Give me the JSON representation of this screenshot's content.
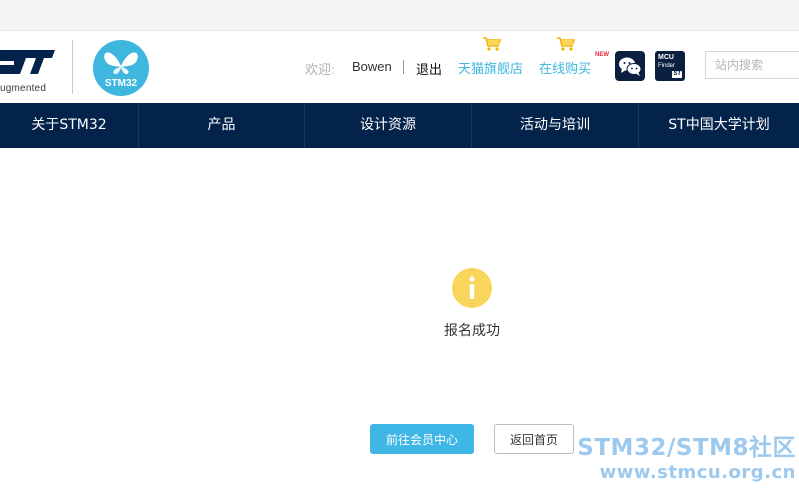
{
  "header": {
    "st_tagline": "ugmented",
    "stm_badge_text": "STM32",
    "welcome_label": "欢迎:",
    "username": "Bowen",
    "logout_label": "退出",
    "tmall_label": "天猫旗舰店",
    "online_label": "在线购买",
    "new_badge": "NEW",
    "mcu_finder": {
      "line1": "MCU",
      "line2": "Finder",
      "logo": "ST"
    },
    "search_placeholder": "站内搜索",
    "icons": [
      "st-logo",
      "stm32-butterfly-badge",
      "cart-icon",
      "wechat-icon",
      "mcu-finder-icon"
    ]
  },
  "nav": {
    "items": [
      {
        "label": "关于STM32"
      },
      {
        "label": "产品"
      },
      {
        "label": "设计资源"
      },
      {
        "label": "活动与培训"
      },
      {
        "label": "ST中国大学计划"
      }
    ]
  },
  "main": {
    "status_icon": "info-icon",
    "status_text": "报名成功",
    "primary_button": "前往会员中心",
    "secondary_button": "返回首页"
  },
  "watermark": {
    "line1": "STM32/STM8社区",
    "line2": "www.stmcu.org.cn"
  },
  "colors": {
    "nav_background": "#03234b",
    "accent": "#3eb6e6",
    "info_icon": "#f9d55b",
    "watermark": "#4c9de0"
  }
}
